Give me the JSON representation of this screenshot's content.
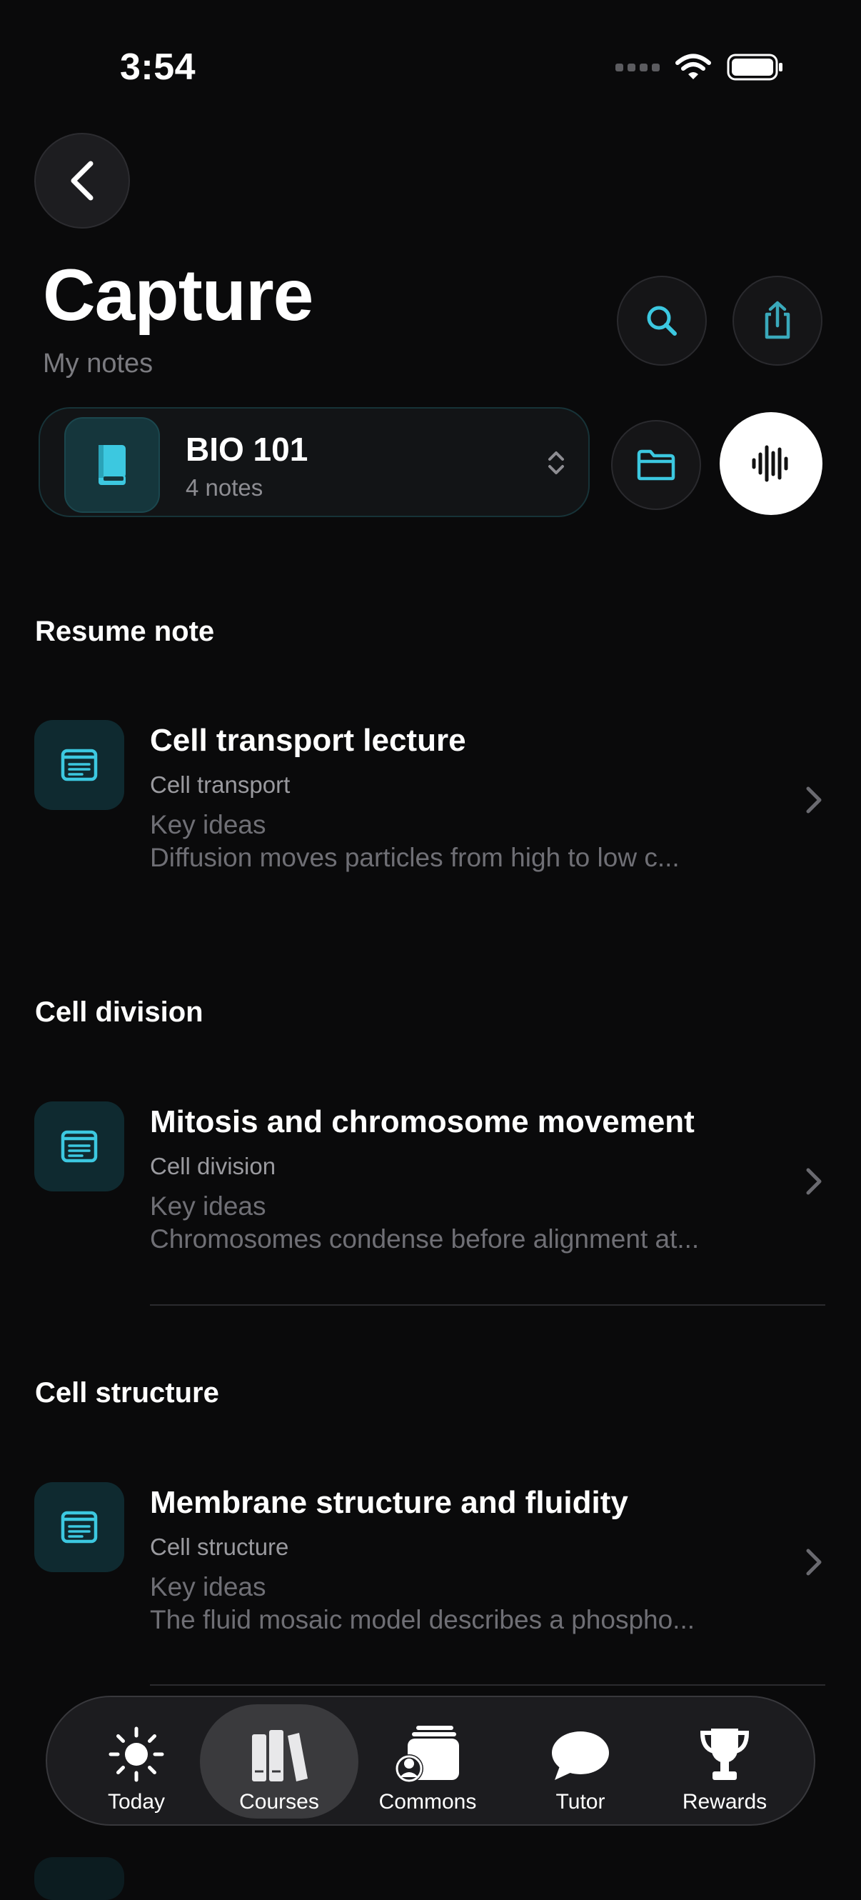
{
  "status_bar": {
    "time": "3:54"
  },
  "header": {
    "title": "Capture",
    "subtitle": "My notes"
  },
  "course": {
    "name": "BIO 101",
    "note_count": "4 notes"
  },
  "sections": [
    {
      "heading": "Resume note",
      "note": {
        "title": "Cell transport lecture",
        "topic": "Cell transport",
        "label": "Key ideas",
        "excerpt": "Diffusion moves particles from high to low c..."
      }
    },
    {
      "heading": "Cell division",
      "note": {
        "title": "Mitosis and chromosome movement",
        "topic": "Cell division",
        "label": "Key ideas",
        "excerpt": "Chromosomes condense before alignment at..."
      }
    },
    {
      "heading": "Cell structure",
      "note": {
        "title": "Membrane structure and fluidity",
        "topic": "Cell structure",
        "label": "Key ideas",
        "excerpt": "The fluid mosaic model describes a phospho..."
      }
    }
  ],
  "tab_bar": {
    "active": "Courses",
    "items": [
      {
        "label": "Today",
        "icon": "sun-icon"
      },
      {
        "label": "Courses",
        "icon": "books-icon"
      },
      {
        "label": "Commons",
        "icon": "commons-icon"
      },
      {
        "label": "Tutor",
        "icon": "chat-bubble-icon"
      },
      {
        "label": "Rewards",
        "icon": "trophy-icon"
      }
    ]
  },
  "colors": {
    "background": "#0a0a0b",
    "accent": "#3cc8e0",
    "muted_text": "#6f6f75"
  }
}
